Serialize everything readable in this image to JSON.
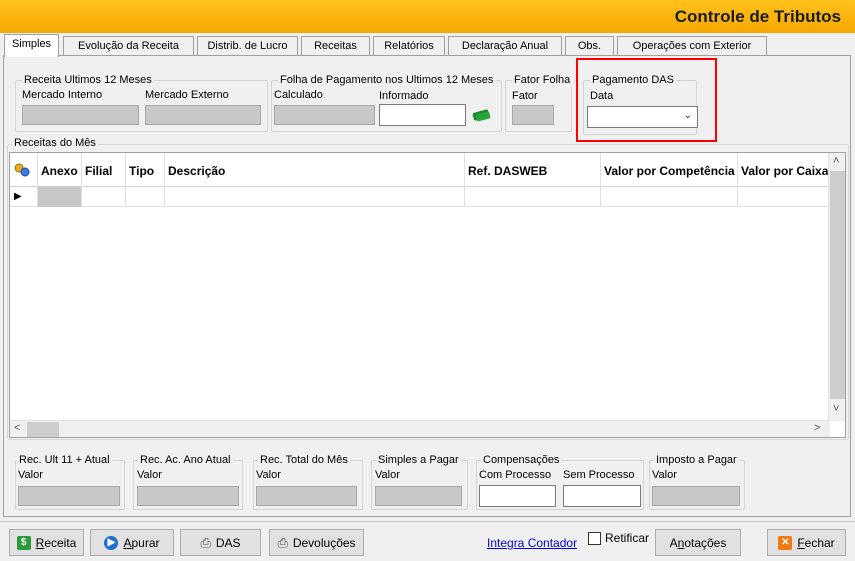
{
  "window": {
    "title": "Controle de Tributos"
  },
  "tabs": [
    {
      "label": "Simples"
    },
    {
      "label": "Evolução da Receita"
    },
    {
      "label": "Distrib. de Lucro"
    },
    {
      "label": "Receitas"
    },
    {
      "label": "Relatórios"
    },
    {
      "label": "Declaração Anual"
    },
    {
      "label": "Obs."
    },
    {
      "label": "Operações com Exterior"
    }
  ],
  "top_groups": {
    "receita12": {
      "title": "Receita Ultimos 12 Meses",
      "mercado_interno_label": "Mercado Interno",
      "mercado_externo_label": "Mercado Externo"
    },
    "folha12": {
      "title": "Folha de Pagamento nos Ultimos 12 Meses",
      "calculado_label": "Calculado",
      "informado_label": "Informado",
      "informado_value": ""
    },
    "fator": {
      "title": "Fator Folha",
      "fator_label": "Fator"
    },
    "pagamento_das": {
      "title": "Pagamento DAS",
      "data_label": "Data",
      "data_value": ""
    }
  },
  "receitas_mes": {
    "title": "Receitas do Mês",
    "columns": [
      {
        "label": ""
      },
      {
        "label": "Anexo"
      },
      {
        "label": "Filial"
      },
      {
        "label": "Tipo"
      },
      {
        "label": "Descrição"
      },
      {
        "label": "Ref. DASWEB"
      },
      {
        "label": "Valor por Competência"
      },
      {
        "label": "Valor por Caixa"
      }
    ],
    "row_marker": "▶"
  },
  "bottom_groups": {
    "rec_ult": {
      "title": "Rec. Ult  11 + Atual",
      "label": "Valor"
    },
    "rec_ac": {
      "title": "Rec. Ac. Ano Atual",
      "label": "Valor"
    },
    "rec_total": {
      "title": "Rec. Total do Mês",
      "label": "Valor"
    },
    "simples_pagar": {
      "title": "Simples a Pagar",
      "label": "Valor"
    },
    "compensacoes": {
      "title": "Compensações",
      "com_label": "Com Processo",
      "sem_label": "Sem Processo"
    },
    "imposto_pagar": {
      "title": "Imposto a Pagar",
      "label": "Valor"
    }
  },
  "footer": {
    "receita": {
      "first": "R",
      "rest": "eceita"
    },
    "apurar": {
      "first": "A",
      "rest": "purar"
    },
    "das": "DAS",
    "devolucoes": "Devoluções",
    "integra": "Integra Contador",
    "retificar": "Retificar",
    "anotacoes": {
      "pre": "A",
      "u": "n",
      "rest": "otações"
    },
    "fechar": {
      "first": "F",
      "rest": "echar"
    }
  },
  "colors": {
    "title_bar": "#f5a800",
    "highlight": "#ff0000",
    "link": "#0000cc"
  }
}
